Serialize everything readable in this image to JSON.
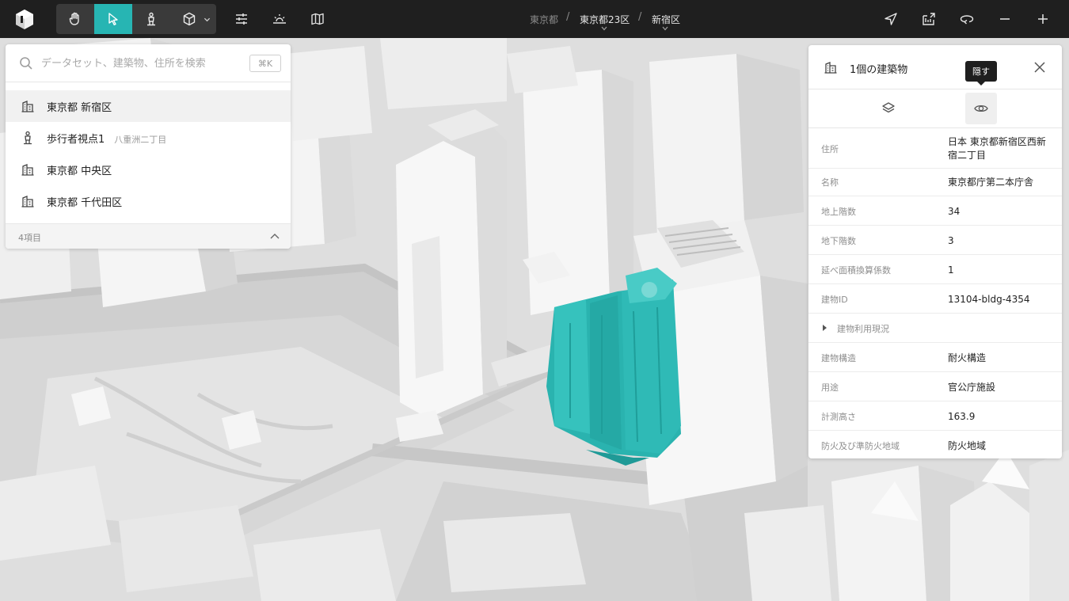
{
  "topbar": {
    "tools": [
      {
        "icon": "hand-icon",
        "active": false
      },
      {
        "icon": "pointer-icon",
        "active": true
      },
      {
        "icon": "pedestrian-icon",
        "active": false
      },
      {
        "icon": "cube-icon",
        "active": false
      }
    ],
    "right_icons": [
      "settings-sliders-icon",
      "sun-horizon-icon",
      "map-icon"
    ],
    "breadcrumb": [
      "東京都",
      "東京都23区",
      "新宿区"
    ],
    "actions": [
      "locate-icon",
      "export-icon",
      "rotate-icon",
      "zoom-out-icon",
      "zoom-in-icon"
    ]
  },
  "search": {
    "placeholder": "データセット、建築物、住所を検索",
    "shortcut": "⌘K",
    "results": [
      {
        "icon": "building-icon",
        "label": "東京都 新宿区",
        "sub": ""
      },
      {
        "icon": "pedestrian-icon",
        "label": "歩行者視点1",
        "sub": "八重洲二丁目"
      },
      {
        "icon": "building-icon",
        "label": "東京都 中央区",
        "sub": ""
      },
      {
        "icon": "building-icon",
        "label": "東京都 千代田区",
        "sub": ""
      }
    ],
    "count": "4項目"
  },
  "inspector": {
    "title": "1個の建築物",
    "tooltip": "隠す",
    "properties": [
      {
        "key": "住所",
        "value": "日本 東京都新宿区西新宿二丁目"
      },
      {
        "key": "名称",
        "value": "東京都庁第二本庁舎"
      },
      {
        "key": "地上階数",
        "value": "34"
      },
      {
        "key": "地下階数",
        "value": "3"
      },
      {
        "key": "延べ面積換算係数",
        "value": "1"
      },
      {
        "key": "建物ID",
        "value": "13104-bldg-4354"
      },
      {
        "key": "建物利用現況",
        "value": ""
      },
      {
        "key": "建物構造",
        "value": "耐火構造"
      },
      {
        "key": "用途",
        "value": "官公庁施設"
      },
      {
        "key": "計測高さ",
        "value": "163.9"
      },
      {
        "key": "防火及び準防火地域",
        "value": "防火地域"
      }
    ]
  },
  "colors": {
    "accent": "#27b5b3",
    "selected_building": "#2fb8b4",
    "topbar": "#1f1f1f"
  }
}
